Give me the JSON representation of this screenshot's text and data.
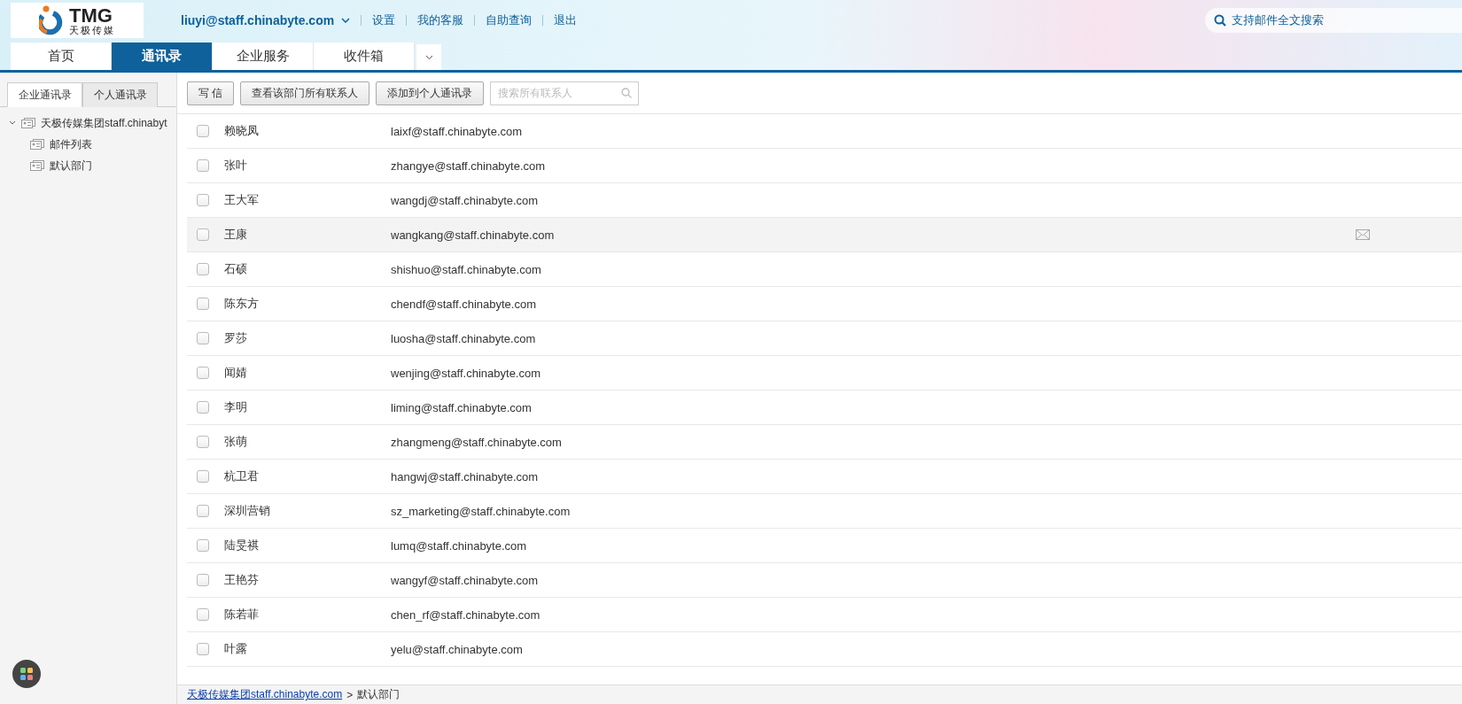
{
  "header": {
    "logo": {
      "mark": "TMG",
      "subtitle": "天极传媒"
    },
    "account": "liuyi@staff.chinabyte.com",
    "links": [
      "设置",
      "我的客服",
      "自助查询",
      "退出"
    ],
    "search_hint": "支持邮件全文搜索"
  },
  "nav_tabs": [
    {
      "label": "首页",
      "selected": false
    },
    {
      "label": "通讯录",
      "selected": true
    },
    {
      "label": "企业服务",
      "selected": false
    },
    {
      "label": "收件箱",
      "selected": false
    }
  ],
  "sidebar": {
    "tabs": [
      {
        "label": "企业通讯录",
        "selected": true
      },
      {
        "label": "个人通讯录",
        "selected": false
      }
    ],
    "tree": [
      {
        "label": "天极传媒集团staff.chinabyt",
        "expanded": true,
        "children": [
          {
            "label": "邮件列表"
          },
          {
            "label": "默认部门"
          }
        ]
      }
    ]
  },
  "toolbar": {
    "buttons": [
      "写 信",
      "查看该部门所有联系人",
      "添加到个人通讯录"
    ],
    "search": {
      "placeholder": "搜索所有联系人"
    }
  },
  "contacts": [
    {
      "name": "赖晓凤",
      "email": "laixf@staff.chinabyte.com",
      "checked": false,
      "hovered": false
    },
    {
      "name": "张叶",
      "email": "zhangye@staff.chinabyte.com",
      "checked": false,
      "hovered": false
    },
    {
      "name": "王大军",
      "email": "wangdj@staff.chinabyte.com",
      "checked": false,
      "hovered": false
    },
    {
      "name": "王康",
      "email": "wangkang@staff.chinabyte.com",
      "checked": false,
      "hovered": true
    },
    {
      "name": "石硕",
      "email": "shishuo@staff.chinabyte.com",
      "checked": false,
      "hovered": false
    },
    {
      "name": "陈东方",
      "email": "chendf@staff.chinabyte.com",
      "checked": false,
      "hovered": false
    },
    {
      "name": "罗莎",
      "email": "luosha@staff.chinabyte.com",
      "checked": false,
      "hovered": false
    },
    {
      "name": "闻婧",
      "email": "wenjing@staff.chinabyte.com",
      "checked": false,
      "hovered": false
    },
    {
      "name": "李明",
      "email": "liming@staff.chinabyte.com",
      "checked": false,
      "hovered": false
    },
    {
      "name": "张萌",
      "email": "zhangmeng@staff.chinabyte.com",
      "checked": false,
      "hovered": false
    },
    {
      "name": "杭卫君",
      "email": "hangwj@staff.chinabyte.com",
      "checked": false,
      "hovered": false
    },
    {
      "name": "深圳营销",
      "email": "sz_marketing@staff.chinabyte.com",
      "checked": false,
      "hovered": false
    },
    {
      "name": "陆旻祺",
      "email": "lumq@staff.chinabyte.com",
      "checked": false,
      "hovered": false
    },
    {
      "name": "王艳芬",
      "email": "wangyf@staff.chinabyte.com",
      "checked": false,
      "hovered": false
    },
    {
      "name": "陈若菲",
      "email": "chen_rf@staff.chinabyte.com",
      "checked": false,
      "hovered": false
    },
    {
      "name": "叶露",
      "email": "yelu@staff.chinabyte.com",
      "checked": false,
      "hovered": false
    }
  ],
  "breadcrumb": {
    "link": "天极传媒集团staff.chinabyte.com",
    "separator": ">",
    "current": "默认部门"
  }
}
